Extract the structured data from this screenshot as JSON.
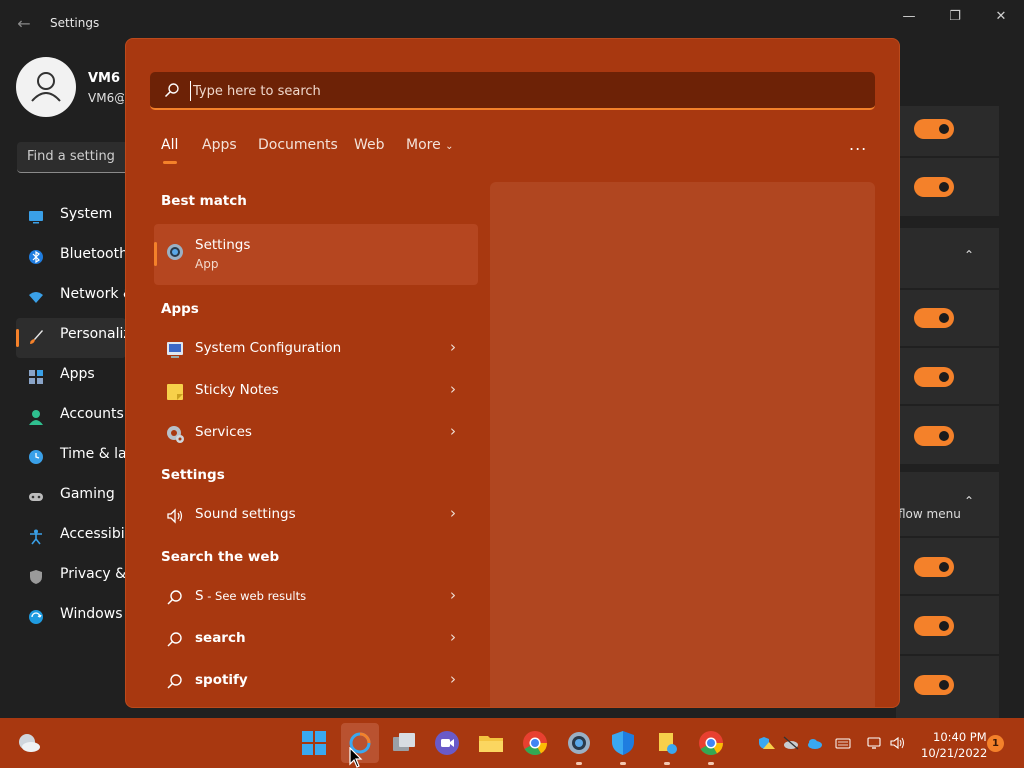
{
  "settings_window": {
    "title": "Settings",
    "user": {
      "name": "VM6",
      "email": "VM6@"
    },
    "search_placeholder": "Find a setting",
    "nav": [
      {
        "label": "System",
        "icon": "monitor-icon"
      },
      {
        "label": "Bluetooth",
        "icon": "bluetooth-icon"
      },
      {
        "label": "Network &",
        "icon": "wifi-icon"
      },
      {
        "label": "Personaliz",
        "icon": "brush-icon",
        "active": true
      },
      {
        "label": "Apps",
        "icon": "apps-icon"
      },
      {
        "label": "Accounts",
        "icon": "person-icon"
      },
      {
        "label": "Time & lar",
        "icon": "clock-icon"
      },
      {
        "label": "Gaming",
        "icon": "gamepad-icon"
      },
      {
        "label": "Accessibilit",
        "icon": "accessibility-icon"
      },
      {
        "label": "Privacy & s",
        "icon": "shield-icon"
      },
      {
        "label": "Windows U",
        "icon": "update-icon"
      }
    ],
    "right_panel": {
      "flow_menu_label": "flow menu"
    }
  },
  "search_panel": {
    "search_placeholder": "Type here to search",
    "tabs": [
      "All",
      "Apps",
      "Documents",
      "Web",
      "More"
    ],
    "more_options": "...",
    "best_match": {
      "heading": "Best match",
      "title": "Settings",
      "subtitle": "App"
    },
    "apps": {
      "heading": "Apps",
      "items": [
        "System Configuration",
        "Sticky Notes",
        "Services"
      ]
    },
    "settings": {
      "heading": "Settings",
      "items": [
        "Sound settings"
      ]
    },
    "web": {
      "heading": "Search the web",
      "items": [
        {
          "query": "S",
          "suffix": " - See web results"
        },
        {
          "query": "search"
        },
        {
          "query": "spotify"
        }
      ]
    }
  },
  "taskbar": {
    "time": "10:40 PM",
    "date": "10/21/2022",
    "notification_count": "1"
  },
  "colors": {
    "accent": "#f4812a",
    "panel_bg": "#a83810",
    "settings_bg": "#202020"
  }
}
